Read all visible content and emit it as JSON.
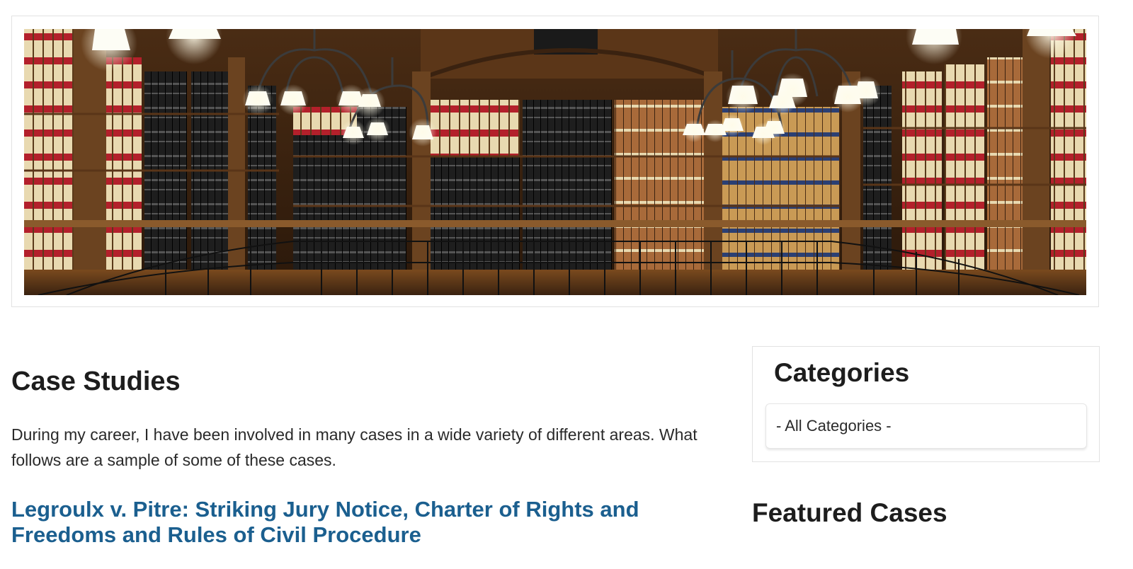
{
  "hero": {
    "image_description": "",
    "colors": {
      "wood_dark": "#3a2210",
      "wood_mid": "#6b4320",
      "wood_light": "#8a5a2c",
      "book_red": "#b3202b",
      "book_cream": "#e8d9b0",
      "book_black": "#1a1a1a",
      "lamp_glow": "#ffffff"
    }
  },
  "main": {
    "title": "Case Studies",
    "intro": "During my career, I have been involved in many cases in a wide variety of different areas. What follows are a sample of some of these cases.",
    "cases": [
      {
        "title": "Legroulx v. Pitre: Striking Jury Notice, Charter of Rights and Freedoms and Rules of Civil Procedure"
      }
    ]
  },
  "sidebar": {
    "categories_title": "Categories",
    "categories_select_value": "- All Categories -",
    "featured_title": "Featured Cases"
  },
  "theme": {
    "link_color": "#1b5f8f",
    "heading_color": "#1d1d1d"
  }
}
